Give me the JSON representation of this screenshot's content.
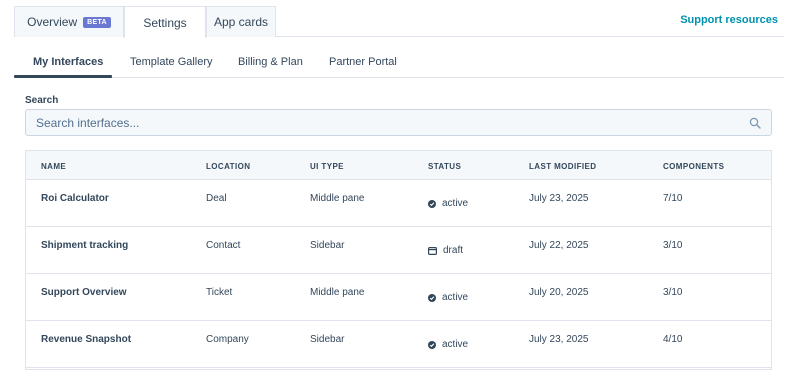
{
  "top_tabs": [
    {
      "label": "Overview",
      "badge": "BETA"
    },
    {
      "label": "Settings",
      "active": true
    },
    {
      "label": "App cards"
    }
  ],
  "support_link": "Support resources",
  "sub_tabs": [
    {
      "label": "My Interfaces",
      "active": true
    },
    {
      "label": "Template Gallery"
    },
    {
      "label": "Billing & Plan"
    },
    {
      "label": "Partner Portal"
    }
  ],
  "search": {
    "label": "Search",
    "placeholder": "Search interfaces...",
    "icon": "search-icon"
  },
  "table": {
    "headers": [
      "NAME",
      "LOCATION",
      "UI TYPE",
      "STATUS",
      "LAST MODIFIED",
      "COMPONENTS"
    ],
    "rows": [
      {
        "name": "Roi Calculator",
        "location": "Deal",
        "ui_type": "Middle pane",
        "status": "active",
        "status_icon": "check-circle-icon",
        "last_modified": "July 23, 2025",
        "components": "7/10"
      },
      {
        "name": "Shipment tracking",
        "location": "Contact",
        "ui_type": "Sidebar",
        "status": "draft",
        "status_icon": "draft-icon",
        "last_modified": "July 22, 2025",
        "components": "3/10"
      },
      {
        "name": "Support Overview",
        "location": "Ticket",
        "ui_type": "Middle pane",
        "status": "active",
        "status_icon": "check-circle-icon",
        "last_modified": "July 20, 2025",
        "components": "3/10"
      },
      {
        "name": "Revenue Snapshot",
        "location": "Company",
        "ui_type": "Sidebar",
        "status": "active",
        "status_icon": "check-circle-icon",
        "last_modified": "July 23, 2025",
        "components": "4/10"
      }
    ]
  },
  "colors": {
    "link": "#0091ae",
    "badge": "#6a78d1",
    "text": "#33475b",
    "header_bg": "#f5f8fa"
  }
}
